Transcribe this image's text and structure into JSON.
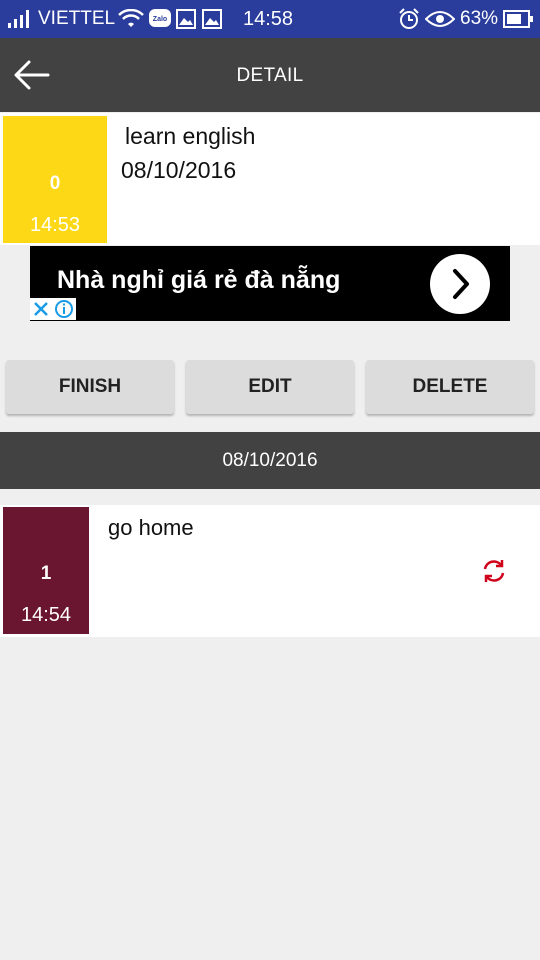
{
  "status_bar": {
    "carrier": "VIETTEL",
    "time": "14:58",
    "battery_percent": "63%",
    "icons": [
      "signal-icon",
      "wifi-icon",
      "zalo-icon",
      "image-icon",
      "image-icon",
      "alarm-icon",
      "eye-icon",
      "battery-icon"
    ]
  },
  "app_bar": {
    "title": "DETAIL",
    "back_icon": "arrow-left-icon"
  },
  "task": {
    "number": "0",
    "time": "14:53",
    "title": "learn english",
    "date": "08/10/2016",
    "badge_color": "#fdd817"
  },
  "ad": {
    "text": "Nhà nghỉ giá rẻ đà nẵng",
    "arrow_icon": "chevron-right-icon",
    "close_icon": "close-icon",
    "info_icon": "info-icon"
  },
  "actions": {
    "finish_label": "FINISH",
    "edit_label": "EDIT",
    "delete_label": "DELETE"
  },
  "section": {
    "date": "08/10/2016"
  },
  "subtasks": [
    {
      "number": "1",
      "time": "14:54",
      "title": "go home",
      "badge_color": "#6b1630",
      "action_icon": "repeat-icon",
      "action_color": "#d0021b"
    }
  ]
}
